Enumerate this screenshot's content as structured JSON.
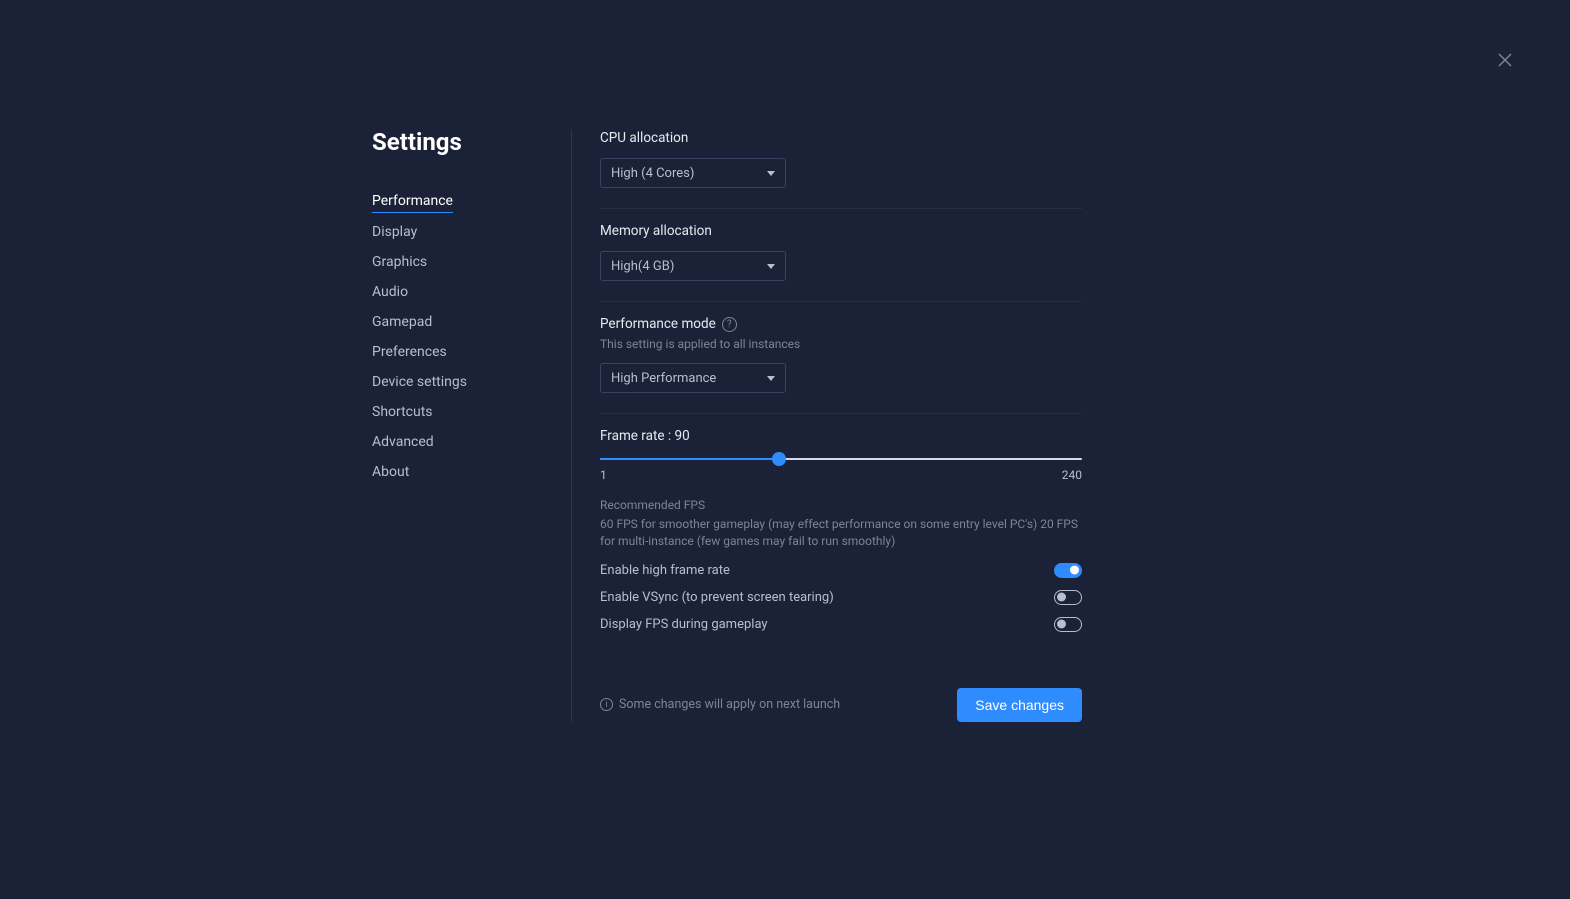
{
  "title": "Settings",
  "sidebar": {
    "items": [
      {
        "label": "Performance",
        "active": true
      },
      {
        "label": "Display",
        "active": false
      },
      {
        "label": "Graphics",
        "active": false
      },
      {
        "label": "Audio",
        "active": false
      },
      {
        "label": "Gamepad",
        "active": false
      },
      {
        "label": "Preferences",
        "active": false
      },
      {
        "label": "Device settings",
        "active": false
      },
      {
        "label": "Shortcuts",
        "active": false
      },
      {
        "label": "Advanced",
        "active": false
      },
      {
        "label": "About",
        "active": false
      }
    ]
  },
  "fields": {
    "cpu": {
      "label": "CPU allocation",
      "value": "High (4 Cores)"
    },
    "memory": {
      "label": "Memory allocation",
      "value": "High(4 GB)"
    },
    "perf_mode": {
      "label": "Performance mode",
      "sublabel": "This setting is applied to all instances",
      "value": "High Performance"
    },
    "frame_rate": {
      "label": "Frame rate : 90",
      "min": "1",
      "max": "240",
      "value": 90,
      "fill_percent": 37.2
    },
    "recommended": {
      "title": "Recommended FPS",
      "body": "60 FPS for smoother gameplay (may effect performance on some entry level PC's) 20 FPS for multi-instance (few games may fail to run smoothly)"
    },
    "toggles": {
      "high_fps": {
        "label": "Enable high frame rate",
        "on": true
      },
      "vsync": {
        "label": "Enable VSync (to prevent screen tearing)",
        "on": false
      },
      "display_fps": {
        "label": "Display FPS during gameplay",
        "on": false
      }
    }
  },
  "footer": {
    "note": "Some changes will apply on next launch",
    "save_label": "Save changes"
  }
}
